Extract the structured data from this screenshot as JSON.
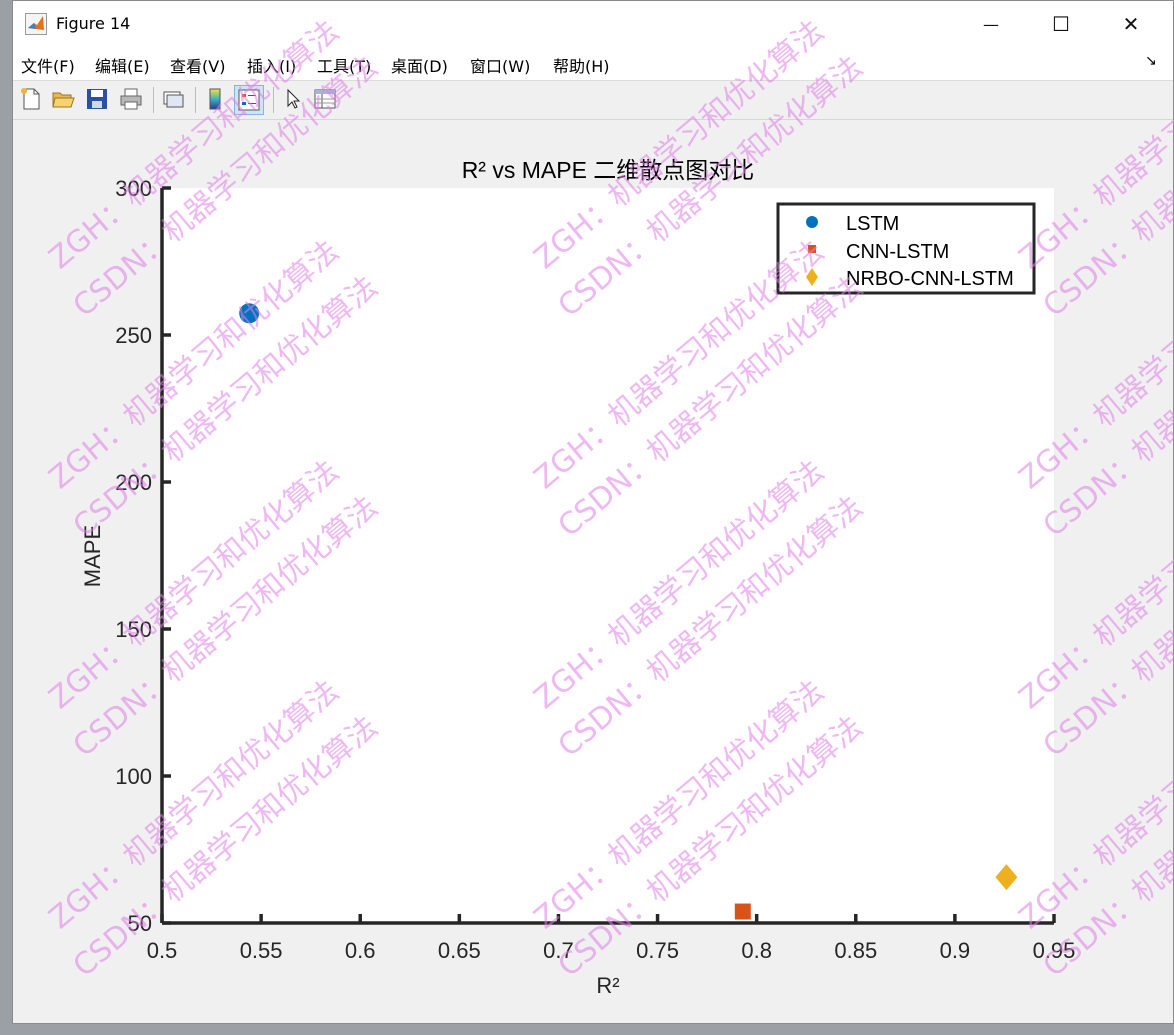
{
  "window": {
    "title": "Figure 14",
    "minimize_glyph": "—",
    "maximize_glyph": "☐",
    "close_glyph": "✕"
  },
  "menu": [
    {
      "label": "文件(F)"
    },
    {
      "label": "编辑(E)"
    },
    {
      "label": "查看(V)"
    },
    {
      "label": "插入(I)"
    },
    {
      "label": "工具(T)"
    },
    {
      "label": "桌面(D)"
    },
    {
      "label": "窗口(W)"
    },
    {
      "label": "帮助(H)"
    }
  ],
  "menu_extra_glyph": "↘",
  "toolbar": {
    "icons": [
      "new-figure-icon",
      "open-file-icon",
      "save-icon",
      "print-icon",
      "link-icon",
      "colorbar-icon",
      "legend-icon",
      "pointer-icon",
      "property-inspector-icon"
    ]
  },
  "chart_data": {
    "type": "scatter",
    "title": "R² vs MAPE 二维散点图对比",
    "xlabel": "R²",
    "ylabel": "MAPE",
    "xlim": [
      0.5,
      0.95
    ],
    "ylim": [
      50,
      300
    ],
    "xticks": [
      "0.5",
      "0.55",
      "0.6",
      "0.65",
      "0.7",
      "0.75",
      "0.8",
      "0.85",
      "0.9",
      "0.95"
    ],
    "yticks": [
      "50",
      "100",
      "150",
      "200",
      "250",
      "300"
    ],
    "grid": false,
    "legend_position": "top-right",
    "series": [
      {
        "name": "LSTM",
        "marker": "circle",
        "color": "#0072bd",
        "points": [
          {
            "x": 0.544,
            "y": 257.4
          }
        ]
      },
      {
        "name": "CNN-LSTM",
        "marker": "square",
        "color": "#d95319",
        "points": [
          {
            "x": 0.793,
            "y": 53.9
          }
        ]
      },
      {
        "name": "NRBO-CNN-LSTM",
        "marker": "diamond",
        "color": "#edb120",
        "points": [
          {
            "x": 0.926,
            "y": 65.6
          }
        ]
      }
    ]
  },
  "watermark": {
    "line1": "ZGH：机器学习和优化算法",
    "line2": "CSDN：机器学习和优化算法"
  }
}
